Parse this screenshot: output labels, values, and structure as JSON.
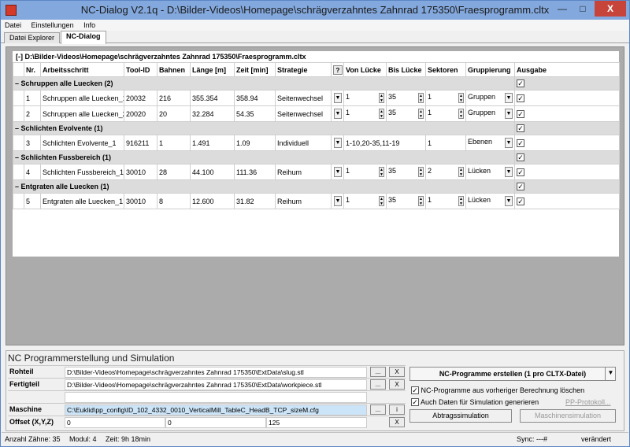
{
  "window": {
    "title": "NC-Dialog V2.1q - D:\\Bilder-Videos\\Homepage\\schrägverzahntes Zahnrad 175350\\Fraesprogramm.cltx",
    "close_glyph": "X"
  },
  "menu": [
    "Datei",
    "Einstellungen",
    "Info"
  ],
  "tabs": [
    "Datei Explorer",
    "NC-Dialog"
  ],
  "tree_header": "[-] D:\\Bilder-Videos\\Homepage\\schrägverzahntes Zahnrad 175350\\Fraesprogramm.cltx",
  "columns": {
    "nr": "Nr.",
    "arbeitsschritt": "Arbeitsschritt",
    "tool_id": "Tool-ID",
    "bahnen": "Bahnen",
    "laenge": "Länge [m]",
    "zeit": "Zeit [min]",
    "strategie": "Strategie",
    "help": "?",
    "von": "Von Lücke",
    "bis": "Bis Lücke",
    "sektoren": "Sektoren",
    "gruppierung": "Gruppierung",
    "ausgabe": "Ausgabe"
  },
  "groups": [
    {
      "label": "Schruppen alle Luecken (2)"
    },
    {
      "label": "Schlichten Evolvente (1)"
    },
    {
      "label": "Schlichten Fussbereich (1)"
    },
    {
      "label": "Entgraten alle Luecken (1)"
    }
  ],
  "rows": [
    {
      "nr": "1",
      "name": "Schruppen alle Luecken_1",
      "tool": "20032",
      "bahnen": "216",
      "laenge": "355.354",
      "zeit": "358.94",
      "strategie": "Seitenwechsel",
      "von": "1",
      "bis": "35",
      "sektoren": "1",
      "gruppierung": "Gruppen"
    },
    {
      "nr": "2",
      "name": "Schruppen alle Luecken_2",
      "tool": "20020",
      "bahnen": "20",
      "laenge": "32.284",
      "zeit": "54.35",
      "strategie": "Seitenwechsel",
      "von": "1",
      "bis": "35",
      "sektoren": "1",
      "gruppierung": "Gruppen"
    },
    {
      "nr": "3",
      "name": "Schlichten Evolvente_1",
      "tool": "916211",
      "bahnen": "1",
      "laenge": "1.491",
      "zeit": "1.09",
      "strategie": "Individuell",
      "von": "1-10,20-35,11-19",
      "bis": "",
      "sektoren": "1",
      "gruppierung": "Ebenen"
    },
    {
      "nr": "4",
      "name": "Schlichten Fussbereich_1",
      "tool": "30010",
      "bahnen": "28",
      "laenge": "44.100",
      "zeit": "111.36",
      "strategie": "Reihum",
      "von": "1",
      "bis": "35",
      "sektoren": "2",
      "gruppierung": "Lücken"
    },
    {
      "nr": "5",
      "name": "Entgraten alle Luecken_1",
      "tool": "30010",
      "bahnen": "8",
      "laenge": "12.600",
      "zeit": "31.82",
      "strategie": "Reihum",
      "von": "1",
      "bis": "35",
      "sektoren": "1",
      "gruppierung": "Lücken"
    }
  ],
  "nc": {
    "section_title": "NC Programmerstellung und Simulation",
    "rohteil_label": "Rohteil",
    "rohteil_value": "D:\\Bilder-Videos\\Homepage\\schrägverzahntes Zahnrad 175350\\ExtData\\slug.stl",
    "fertigteil_label": "Fertigteil",
    "fertigteil_value": "D:\\Bilder-Videos\\Homepage\\schrägverzahntes Zahnrad 175350\\ExtData\\workpiece.stl",
    "maschine_label": "Maschine",
    "maschine_value": "C:\\Euklid\\pp_config\\ID_102_4332_0010_VerticalMill_TableC_HeadB_TCP_sizeM.cfg",
    "offset_label": "Offset (X,Y,Z)",
    "offset_x": "0",
    "offset_y": "0",
    "offset_z": "125",
    "browse": "...",
    "clear": "X",
    "info": "i",
    "create_button": "NC-Programme erstellen (1 pro CLTX-Datei)",
    "opt_delete": "NC-Programme aus vorheriger Berechnung löschen",
    "opt_sim": "Auch Daten für Simulation generieren",
    "pp_log": "PP-Protokoll...",
    "abtrag_button": "Abtragssimulation",
    "maschinen_button": "Maschinensimulation"
  },
  "status": {
    "zaehne": "Anzahl Zähne: 35",
    "modul": "Modul: 4",
    "zeit": "Zeit: 9h 18min",
    "sync": "Sync: ---#",
    "changed": "verändert"
  }
}
